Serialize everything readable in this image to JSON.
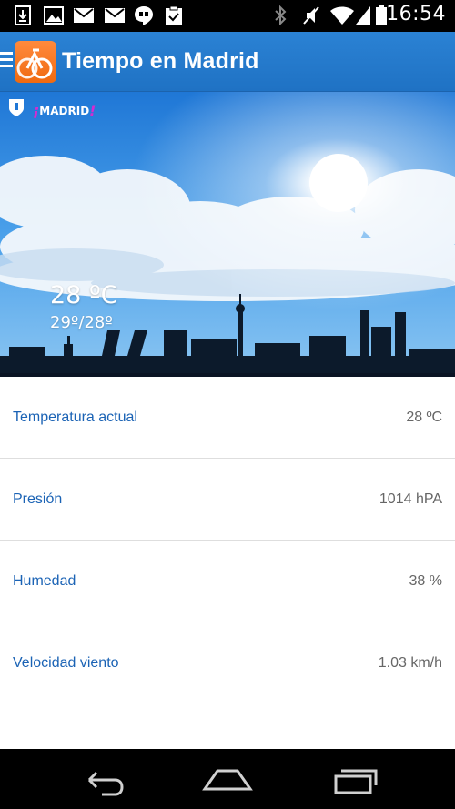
{
  "status_bar": {
    "time": "16:54",
    "icons": [
      "download-icon",
      "image-icon",
      "gmail-icon",
      "gmail-icon",
      "hangouts-icon",
      "clipboard-check-icon",
      "bluetooth-icon",
      "mute-icon",
      "wifi-icon",
      "signal-icon",
      "battery-icon"
    ]
  },
  "app_bar": {
    "title": "Tiempo en Madrid",
    "menu_icon": "menu-icon",
    "logo_icon": "bicycle-logo-icon",
    "brand_color": "#2277cc",
    "logo_color": "#f57020"
  },
  "hero": {
    "brand_text": "MADRID",
    "current_temp": "28 ºC",
    "range": "29º/28º"
  },
  "weather_rows": [
    {
      "label": "Temperatura actual",
      "value": "28 ºC"
    },
    {
      "label": "Presión",
      "value": "1014 hPA"
    },
    {
      "label": "Humedad",
      "value": "38 %"
    },
    {
      "label": "Velocidad viento",
      "value": "1.03 km/h"
    }
  ],
  "colors": {
    "label_text": "#1b63b5",
    "value_text": "#666666",
    "sky_blue": "#2f8ee0"
  },
  "nav_bar": {
    "icons": [
      "back-icon",
      "home-icon",
      "recents-icon"
    ]
  }
}
